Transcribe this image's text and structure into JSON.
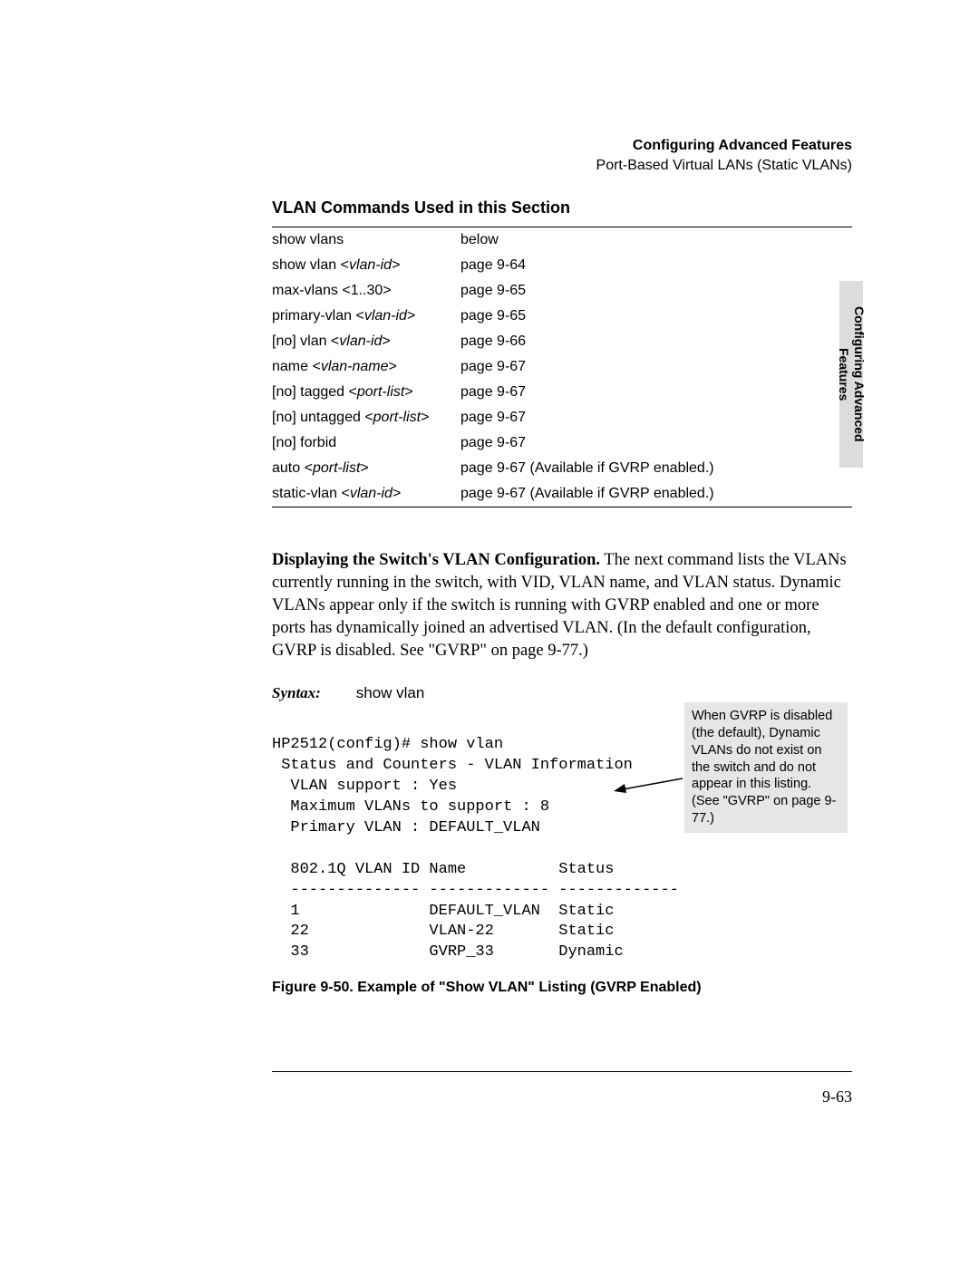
{
  "header": {
    "title": "Configuring Advanced Features",
    "subtitle": "Port-Based Virtual LANs (Static VLANs)"
  },
  "sideTab": "Configuring Advanced\nFeatures",
  "sectionTitle": "VLAN Commands Used in this Section",
  "commands": [
    {
      "cmd": "show vlans",
      "ref": "below",
      "ital": ""
    },
    {
      "cmd": "show vlan <vlan-id>",
      "ref": "page 9-64",
      "ital": "vlan-id"
    },
    {
      "cmd": "max-vlans <1..30>",
      "ref": "page 9-65",
      "ital": ""
    },
    {
      "cmd": "primary-vlan <vlan-id>",
      "ref": "page 9-65",
      "ital": "vlan-id"
    },
    {
      "cmd": "[no] vlan <vlan-id>",
      "ref": "page 9-66",
      "ital": "vlan-id"
    },
    {
      "cmd": "name <vlan-name>",
      "ref": "page 9-67",
      "ital": "vlan-name"
    },
    {
      "cmd": "[no] tagged <port-list>",
      "ref": "page 9-67",
      "ital": "port-list"
    },
    {
      "cmd": "[no] untagged <port-list>",
      "ref": "page 9-67",
      "ital": "port-list"
    },
    {
      "cmd": "[no] forbid",
      "ref": "page 9-67",
      "ital": ""
    },
    {
      "cmd": "auto <port-list>",
      "ref": "page 9-67 (Available if GVRP enabled.)",
      "ital": "port-list"
    },
    {
      "cmd": "static-vlan <vlan-id>",
      "ref": "page 9-67 (Available if GVRP enabled.)",
      "ital": "vlan-id"
    }
  ],
  "paraLead": "Displaying the Switch's VLAN Configuration.",
  "paraBody": "  The next command lists the VLANs currently running in the switch, with VID, VLAN name, and VLAN status. Dynamic VLANs appear only if the switch is running with GVRP enabled and one or more ports has dynamically joined an advertised VLAN. (In the default configuration, GVRP is disabled. See \"GVRP\" on page 9-77.)",
  "syntaxLabel": "Syntax:",
  "syntaxCmd": "show vlan",
  "terminal": "HP2512(config)# show vlan\n Status and Counters - VLAN Information\n  VLAN support : Yes\n  Maximum VLANs to support : 8\n  Primary VLAN : DEFAULT_VLAN\n\n  802.1Q VLAN ID Name          Status\n  -------------- ------------- -------------\n  1              DEFAULT_VLAN  Static\n  22             VLAN-22       Static\n  33             GVRP_33       Dynamic",
  "callout": "When GVRP is disabled (the default), Dynamic VLANs do not exist on the switch and do not appear in this listing. (See \"GVRP\" on page 9-77.)",
  "figCaption": "Figure 9-50.  Example of \"Show VLAN\" Listing (GVRP Enabled)",
  "pageNum": "9-63"
}
